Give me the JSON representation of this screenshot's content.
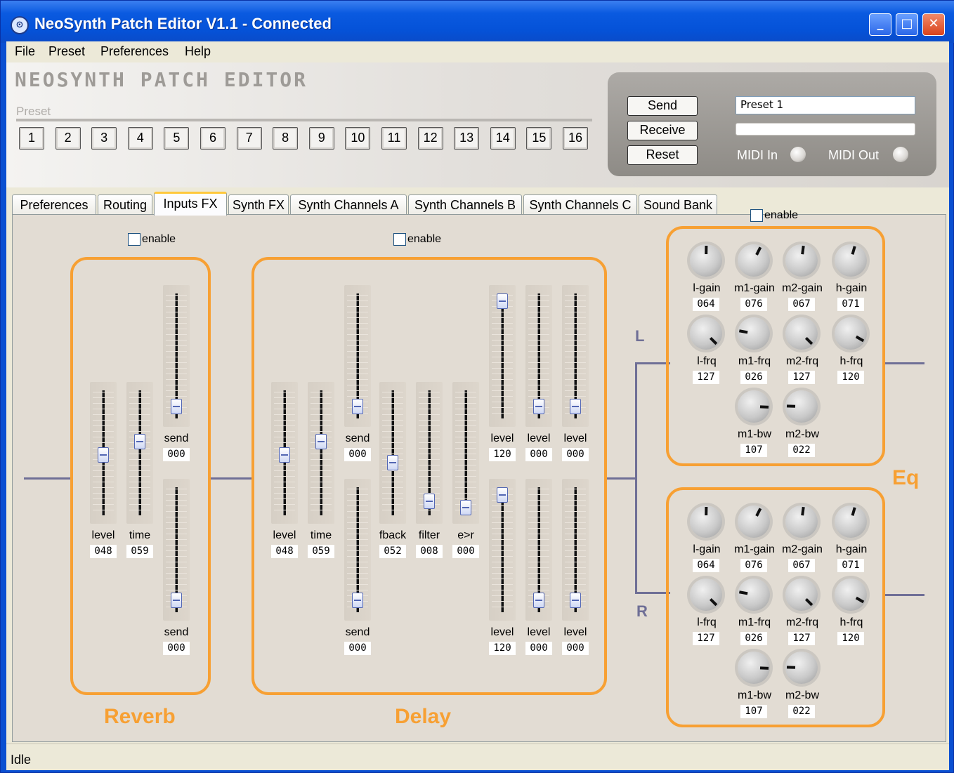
{
  "window": {
    "title": "NeoSynth Patch Editor V1.1 - Connected",
    "icon": "midi-connector-icon"
  },
  "menu": [
    "File",
    "Preset",
    "Preferences",
    "Help"
  ],
  "banner": {
    "logo": "NEOSYNTH PATCH EDITOR",
    "preset_label": "Preset",
    "presets": [
      "1",
      "2",
      "3",
      "4",
      "5",
      "6",
      "7",
      "8",
      "9",
      "10",
      "11",
      "12",
      "13",
      "14",
      "15",
      "16"
    ],
    "selected_preset": "1"
  },
  "controls": {
    "send": "Send",
    "receive": "Receive",
    "reset": "Reset",
    "preset_name": "Preset 1",
    "midi_in": "MIDI In",
    "midi_out": "MIDI Out"
  },
  "tabs": [
    "Preferences",
    "Routing",
    "Inputs FX",
    "Synth FX",
    "Synth Channels A",
    "Synth Channels B",
    "Synth Channels C",
    "Sound Bank"
  ],
  "active_tab": "Inputs FX",
  "enable": "enable",
  "reverb": {
    "title": "Reverb",
    "level": {
      "label": "level",
      "value": "048"
    },
    "time": {
      "label": "time",
      "value": "059"
    },
    "send_top": {
      "label": "send",
      "value": "000"
    },
    "send_bottom": {
      "label": "send",
      "value": "000"
    }
  },
  "delay": {
    "title": "Delay",
    "level": {
      "label": "level",
      "value": "048"
    },
    "time": {
      "label": "time",
      "value": "059"
    },
    "send_top": {
      "label": "send",
      "value": "000"
    },
    "send_bottom": {
      "label": "send",
      "value": "000"
    },
    "fback": {
      "label": "fback",
      "value": "052"
    },
    "filter": {
      "label": "filter",
      "value": "008"
    },
    "elr": {
      "label": "e>r",
      "value": "000"
    },
    "out_top": [
      {
        "label": "level",
        "value": "120"
      },
      {
        "label": "level",
        "value": "000"
      },
      {
        "label": "level",
        "value": "000"
      }
    ],
    "out_bottom": [
      {
        "label": "level",
        "value": "120"
      },
      {
        "label": "level",
        "value": "000"
      },
      {
        "label": "level",
        "value": "000"
      }
    ]
  },
  "eq": {
    "title": "Eq",
    "left_label": "L",
    "right_label": "R",
    "left": {
      "gain": [
        {
          "label": "l-gain",
          "value": "064"
        },
        {
          "label": "m1-gain",
          "value": "076"
        },
        {
          "label": "m2-gain",
          "value": "067"
        },
        {
          "label": "h-gain",
          "value": "071"
        }
      ],
      "frq": [
        {
          "label": "l-frq",
          "value": "127"
        },
        {
          "label": "m1-frq",
          "value": "026"
        },
        {
          "label": "m2-frq",
          "value": "127"
        },
        {
          "label": "h-frq",
          "value": "120"
        }
      ],
      "bw": [
        {
          "label": "m1-bw",
          "value": "107"
        },
        {
          "label": "m2-bw",
          "value": "022"
        }
      ]
    },
    "right": {
      "gain": [
        {
          "label": "l-gain",
          "value": "064"
        },
        {
          "label": "m1-gain",
          "value": "076"
        },
        {
          "label": "m2-gain",
          "value": "067"
        },
        {
          "label": "h-gain",
          "value": "071"
        }
      ],
      "frq": [
        {
          "label": "l-frq",
          "value": "127"
        },
        {
          "label": "m1-frq",
          "value": "026"
        },
        {
          "label": "m2-frq",
          "value": "127"
        },
        {
          "label": "h-frq",
          "value": "120"
        }
      ],
      "bw": [
        {
          "label": "m1-bw",
          "value": "107"
        },
        {
          "label": "m2-bw",
          "value": "022"
        }
      ]
    }
  },
  "status": "Idle",
  "colors": {
    "accent": "#f7a033",
    "wire": "#6f6f96",
    "title_bar": "#0a5ae0"
  }
}
